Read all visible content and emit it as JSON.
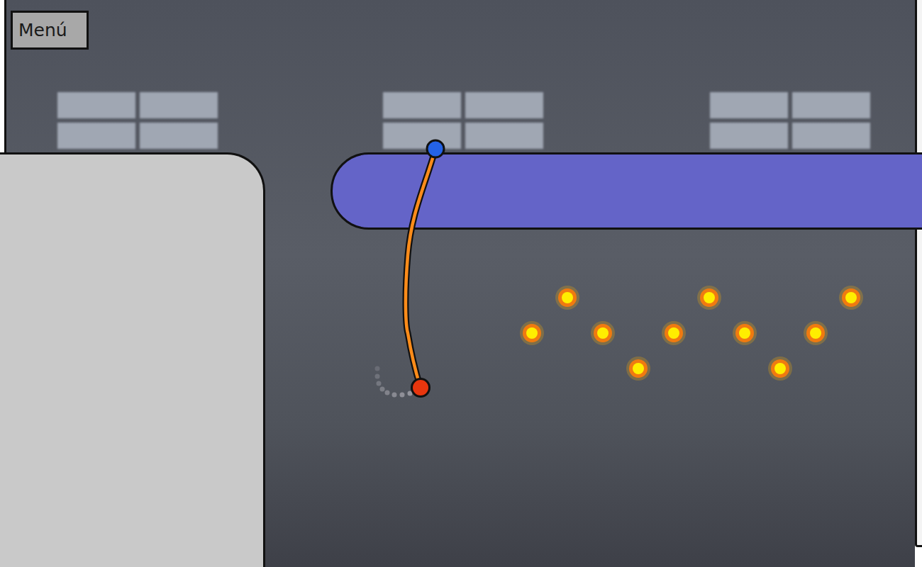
{
  "menu_button": {
    "label": "Menú"
  },
  "coins": [
    {
      "collected": false
    },
    {
      "collected": false
    },
    {
      "collected": false
    },
    {
      "collected": false
    },
    {
      "collected": false
    },
    {
      "collected": false
    },
    {
      "collected": false
    },
    {
      "collected": false
    },
    {
      "collected": false
    },
    {
      "collected": false
    }
  ]
}
